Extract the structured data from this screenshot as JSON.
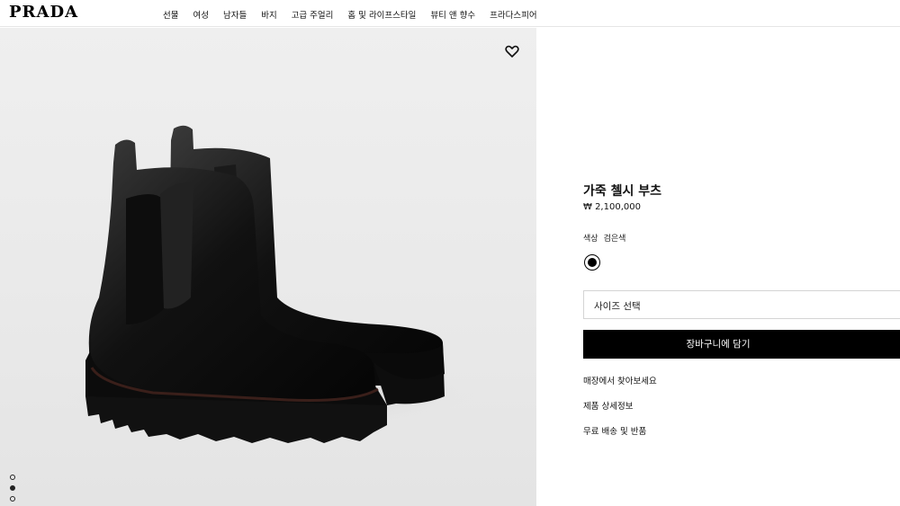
{
  "brand": {
    "logo": "PRADA"
  },
  "nav": {
    "items": [
      "선물",
      "여성",
      "남자들",
      "바지",
      "고급 주얼리",
      "홈 및 라이프스타일",
      "뷰티 앤 향수",
      "프라다스피어"
    ]
  },
  "gallery": {
    "wishlist_icon": "heart-icon",
    "dots_count": 3,
    "active_dot": 1
  },
  "product": {
    "title": "가죽 첼시 부츠",
    "price": "₩ 2,100,000",
    "color_label": "색상",
    "color_value": "검은색",
    "swatch_color": "#000000",
    "size_placeholder": "사이즈 선택",
    "add_to_cart": "장바구니에 담기",
    "links": {
      "find_in_store": "매장에서 찾아보세요",
      "details": "제품 상세정보",
      "shipping": "무료 배송 및 반품"
    }
  }
}
